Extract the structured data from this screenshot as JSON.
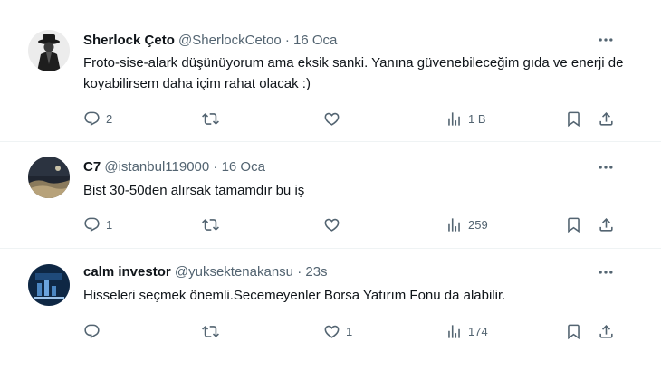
{
  "tweets": [
    {
      "name": "Sherlock Çeto",
      "handle": "@SherlockCetoo",
      "sep": "·",
      "date": "16 Oca",
      "text": "Froto-sise-alark düşünüyorum ama eksik sanki. Yanına güvenebileceğim gıda ve enerji de koyabilirsem daha içim rahat olacak :)",
      "replies": "2",
      "retweets": "",
      "likes": "",
      "views": "1 B",
      "avatar_icon": "avatar-silhouette-hat"
    },
    {
      "name": "C7",
      "handle": "@istanbul119000",
      "sep": "·",
      "date": "16 Oca",
      "text": "Bist 30-50den alırsak tamamdır bu iş",
      "replies": "1",
      "retweets": "",
      "likes": "",
      "views": "259",
      "avatar_icon": "avatar-landscape"
    },
    {
      "name": "calm investor",
      "handle": "@yuksektenakansu",
      "sep": "·",
      "date": "23s",
      "text": "Hisseleri seçmek önemli.Secemeyenler Borsa Yatırım Fonu da alabilir.",
      "replies": "",
      "retweets": "",
      "likes": "1",
      "views": "174",
      "avatar_icon": "avatar-investor-logo"
    }
  ],
  "icons": {
    "reply": "reply-icon",
    "retweet": "retweet-icon",
    "like": "like-icon",
    "views": "views-icon",
    "bookmark": "bookmark-icon",
    "share": "share-icon",
    "more": "more-icon"
  },
  "colors": {
    "text": "#0f1419",
    "secondary": "#536471",
    "divider": "#eff3f4"
  }
}
